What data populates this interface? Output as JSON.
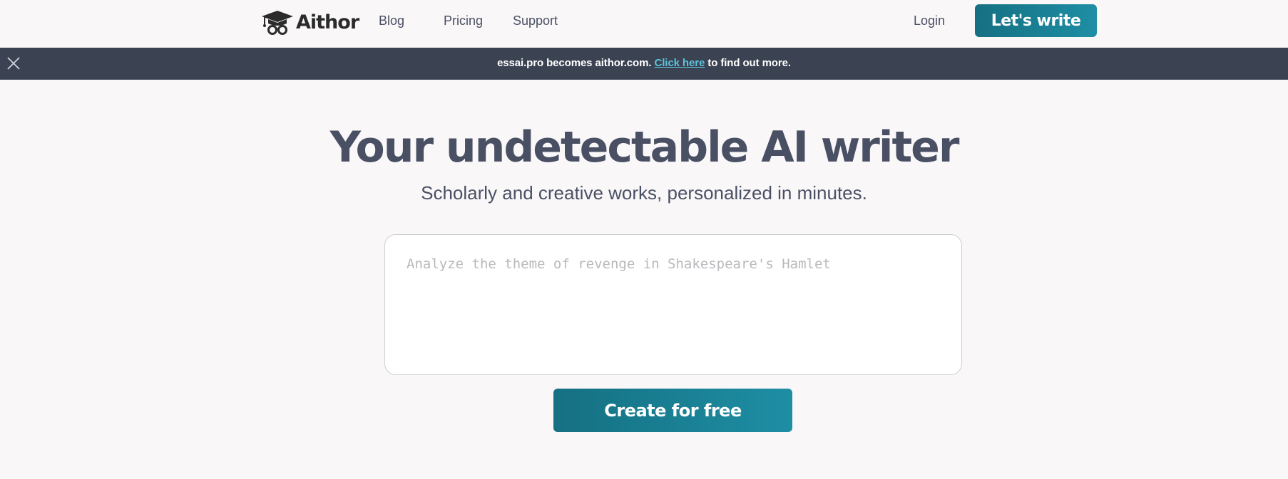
{
  "header": {
    "logo_text": "Aithor",
    "logo_icon": "graduation-cap-glasses-icon",
    "nav": {
      "blog": "Blog",
      "pricing": "Pricing",
      "support": "Support"
    },
    "login_label": "Login",
    "cta_label": "Let's write"
  },
  "banner": {
    "text_before": "essai.pro becomes aithor.com.",
    "link_text": "Click here",
    "text_after": "to find out more.",
    "close_icon": "close-icon"
  },
  "hero": {
    "title": "Your undetectable AI writer",
    "subtitle": "Scholarly and creative works, personalized in minutes.",
    "prompt_placeholder": "Analyze the theme of revenge in Shakespeare's Hamlet",
    "prompt_value": "",
    "create_label": "Create for free"
  },
  "colors": {
    "accent": "#1b7f93",
    "banner_bg": "#3b4252",
    "banner_link": "#5ec2d8",
    "text": "#4a5064",
    "page_bg": "#f9f7f8"
  }
}
